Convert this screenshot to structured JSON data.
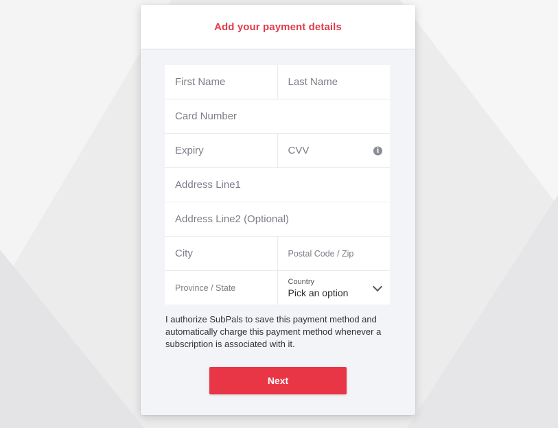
{
  "header": {
    "title": "Add your payment details"
  },
  "form": {
    "first_name": {
      "placeholder": "First Name"
    },
    "last_name": {
      "placeholder": "Last Name"
    },
    "card_number": {
      "placeholder": "Card Number"
    },
    "expiry": {
      "placeholder": "Expiry"
    },
    "cvv": {
      "placeholder": "CVV",
      "info_icon": "info-icon"
    },
    "address_line1": {
      "placeholder": "Address Line1"
    },
    "address_line2": {
      "placeholder": "Address Line2 (Optional)"
    },
    "city": {
      "placeholder": "City"
    },
    "postal_code": {
      "placeholder": "Postal Code / Zip"
    },
    "province": {
      "placeholder": "Province / State"
    },
    "country": {
      "label": "Country",
      "selected": "Pick an option",
      "icon": "chevron-down-icon"
    }
  },
  "consent_text": "I authorize SubPals to save this payment method and automatically charge this payment method whenever a subscription is associated with it.",
  "actions": {
    "next_label": "Next"
  },
  "colors": {
    "accent": "#e93646",
    "title": "#e23b4a",
    "card_bg": "#f3f4f7"
  }
}
